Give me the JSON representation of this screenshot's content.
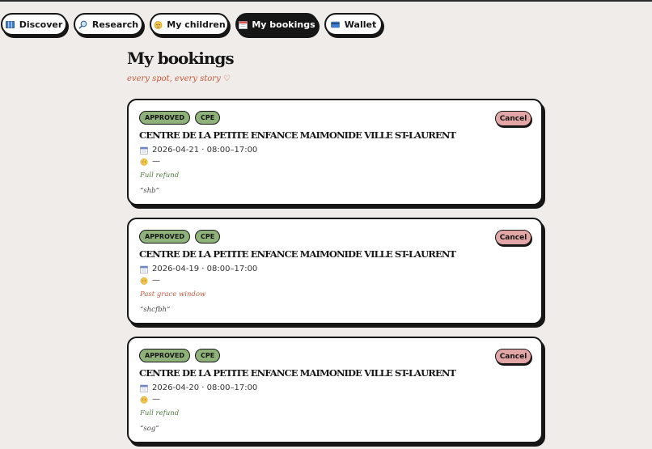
{
  "nav": {
    "items": [
      {
        "label": "Discover",
        "icon": "map-icon",
        "active": false
      },
      {
        "label": "Research",
        "icon": "magnifier-icon",
        "active": false
      },
      {
        "label": "My children",
        "icon": "baby-icon",
        "active": false
      },
      {
        "label": "My bookings",
        "icon": "calendar-icon",
        "active": true
      },
      {
        "label": "Wallet",
        "icon": "card-icon",
        "active": false
      }
    ]
  },
  "header": {
    "title": "My bookings",
    "subtitle": "every spot, every story",
    "subtitle_icon": "heart-icon"
  },
  "colors": {
    "background": "#f0ece9",
    "ink": "#161616",
    "badge_green": "#8fb27b",
    "cancel_pink": "#e3a6a6",
    "refund_green": "#4e7a3e",
    "grace_red": "#c25b3d"
  },
  "bookings": [
    {
      "status": "APPROVED",
      "type": "CPE",
      "name": "CENTRE DE LA PETITE ENFANCE MAIMONIDE VILLE ST-LAURENT",
      "datetime": "2026-04-21 · 08:00–17:00",
      "child": "—",
      "refund": "Full refund",
      "refund_status": "ok",
      "note": "“shb”",
      "cancel_label": "Cancel"
    },
    {
      "status": "APPROVED",
      "type": "CPE",
      "name": "CENTRE DE LA PETITE ENFANCE MAIMONIDE VILLE ST-LAURENT",
      "datetime": "2026-04-19 · 08:00–17:00",
      "child": "—",
      "refund": "Past grace window",
      "refund_status": "late",
      "note": "“shcfbh”",
      "cancel_label": "Cancel"
    },
    {
      "status": "APPROVED",
      "type": "CPE",
      "name": "CENTRE DE LA PETITE ENFANCE MAIMONIDE VILLE ST-LAURENT",
      "datetime": "2026-04-20 · 08:00–17:00",
      "child": "—",
      "refund": "Full refund",
      "refund_status": "ok",
      "note": "“sog”",
      "cancel_label": "Cancel"
    }
  ]
}
